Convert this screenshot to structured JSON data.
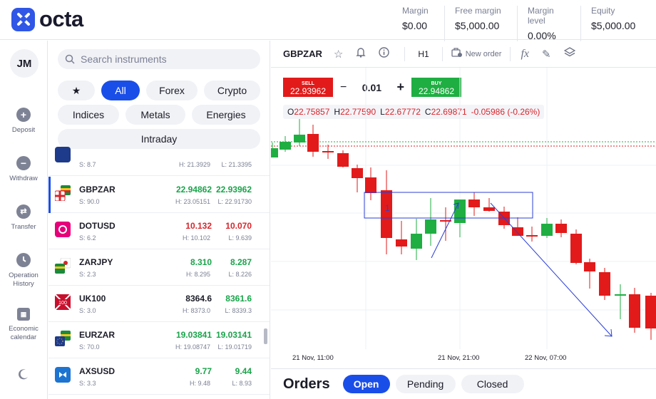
{
  "brand": {
    "name": "octa"
  },
  "account": [
    {
      "label": "Margin",
      "value": "$0.00"
    },
    {
      "label": "Free margin",
      "value": "$5,000.00"
    },
    {
      "label": "Margin level",
      "value": "0.00%"
    },
    {
      "label": "Equity",
      "value": "$5,000.00"
    }
  ],
  "nav": {
    "avatar": "JM",
    "items": [
      {
        "label": "Deposit",
        "icon": "plus-circle-icon"
      },
      {
        "label": "Withdraw",
        "icon": "minus-circle-icon"
      },
      {
        "label": "Transfer",
        "icon": "transfer-icon"
      },
      {
        "label": "Operation History",
        "icon": "clock-icon"
      },
      {
        "label": "Economic calendar",
        "icon": "calendar-icon"
      }
    ],
    "theme_icon": "moon-icon"
  },
  "search": {
    "placeholder": "Search instruments"
  },
  "filters": [
    "All",
    "Forex",
    "Crypto",
    "Indices",
    "Metals",
    "Energies",
    "Intraday"
  ],
  "instruments": [
    {
      "symbol": "",
      "spread": "S: 8.7",
      "bid": "",
      "ask": "",
      "high": "H: 21.3929",
      "low": "L: 21.3395"
    },
    {
      "symbol": "GBPZAR",
      "spread": "S: 90.0",
      "bid": "22.94862",
      "ask": "22.93962",
      "high": "H: 23.05151",
      "low": "L: 22.91730"
    },
    {
      "symbol": "DOTUSD",
      "spread": "S: 6.2",
      "bid": "10.132",
      "ask": "10.070",
      "high": "H: 10.102",
      "low": "L: 9.639"
    },
    {
      "symbol": "ZARJPY",
      "spread": "S: 2.3",
      "bid": "8.310",
      "ask": "8.287",
      "high": "H: 8.295",
      "low": "L: 8.226"
    },
    {
      "symbol": "UK100",
      "spread": "S: 3.0",
      "bid": "8364.6",
      "ask": "8361.6",
      "high": "H: 8373.0",
      "low": "L: 8339.3"
    },
    {
      "symbol": "EURZAR",
      "spread": "S: 70.0",
      "bid": "19.03841",
      "ask": "19.03141",
      "high": "H: 19.08747",
      "low": "L: 19.01719"
    },
    {
      "symbol": "AXSUSD",
      "spread": "S: 3.3",
      "bid": "9.77",
      "ask": "9.44",
      "high": "H: 9.48",
      "low": "L: 8.93"
    }
  ],
  "chart": {
    "symbol": "GBPZAR",
    "timeframe": "H1",
    "new_order": "New order",
    "sell_label": "SELL",
    "sell_price": "22.93962",
    "buy_label": "BUY",
    "buy_price": "22.94862",
    "lot": "0.01",
    "minus": "−",
    "plus": "+",
    "ohlc": {
      "o_key": "O",
      "o": "22.75857",
      "h_key": "H",
      "h": "22.77590",
      "l_key": "L",
      "l": "22.67772",
      "c_key": "C",
      "c": "22.69871",
      "change": "-0.05986 (-0.26%)"
    },
    "time_labels": [
      "21 Nov, 11:00",
      "21 Nov, 21:00",
      "22 Nov, 07:00"
    ]
  },
  "orders": {
    "title": "Orders",
    "tabs": [
      "Open",
      "Pending",
      "Closed"
    ]
  }
}
